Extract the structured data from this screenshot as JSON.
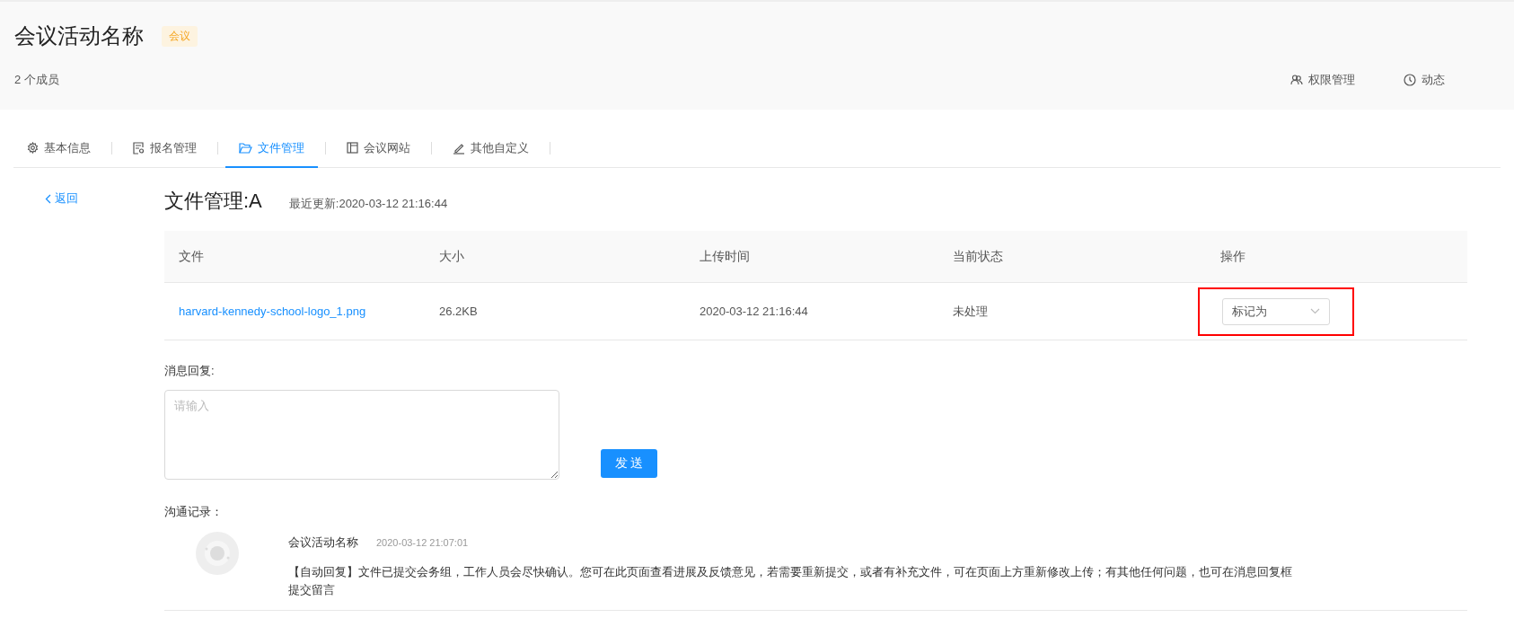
{
  "header": {
    "title": "会议活动名称",
    "tag": "会议",
    "members": "2 个成员",
    "actions": [
      {
        "kind": "permissions",
        "label": "权限管理"
      },
      {
        "kind": "activity",
        "label": "动态"
      }
    ]
  },
  "tabs": [
    {
      "kind": "basic",
      "label": "基本信息",
      "selected": false
    },
    {
      "kind": "registration",
      "label": "报名管理",
      "selected": false
    },
    {
      "kind": "files",
      "label": "文件管理",
      "selected": true
    },
    {
      "kind": "website",
      "label": "会议网站",
      "selected": false
    },
    {
      "kind": "custom",
      "label": "其他自定义",
      "selected": false
    }
  ],
  "back_link": "返回",
  "page": {
    "title": "文件管理:A",
    "updated": "最近更新:2020-03-12 21:16:44"
  },
  "table": {
    "columns": [
      "文件",
      "大小",
      "上传时间",
      "当前状态",
      "操作"
    ],
    "rows": [
      {
        "file": "harvard-kennedy-school-logo_1.png",
        "size": "26.2KB",
        "uploaded": "2020-03-12 21:16:44",
        "status": "未处理",
        "action": {
          "value": "标记为",
          "highlighted": true
        }
      }
    ]
  },
  "reply": {
    "label": "消息回复:",
    "placeholder": "请输入",
    "button": "发 送"
  },
  "log": {
    "label": "沟通记录：",
    "entries": [
      {
        "name": "会议活动名称",
        "time": "2020-03-12 21:07:01",
        "message": "【自动回复】文件已提交会务组，工作人员会尽快确认。您可在此页面查看进展及反馈意见，若需要重新提交，或者有补充文件，可在页面上方重新修改上传；有其他任何问题，也可在消息回复框提交留言"
      }
    ]
  }
}
